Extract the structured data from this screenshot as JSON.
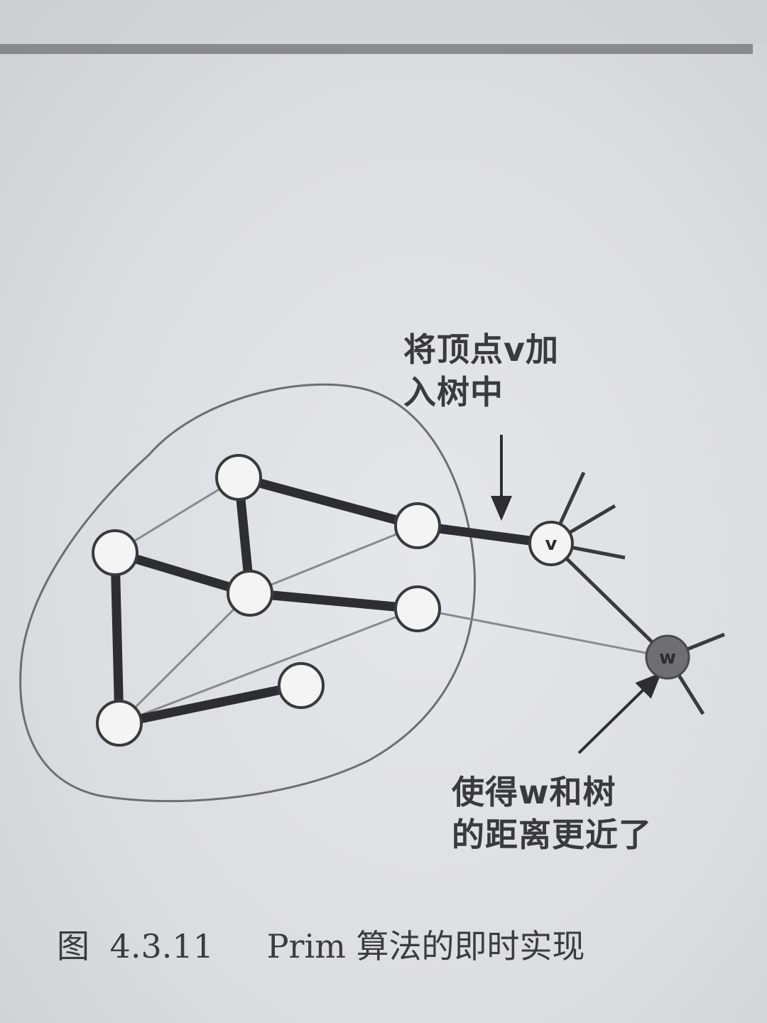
{
  "annotations": {
    "add_vertex_line1": "将顶点v加",
    "add_vertex_line2": "入树中",
    "closer_line1": "使得w和树",
    "closer_line2": "的距离更近了"
  },
  "caption": {
    "prefix": "图",
    "number": "4.3.11",
    "title": "Prim 算法的即时实现"
  },
  "nodes": {
    "v_label": "v",
    "w_label": "w"
  },
  "colors": {
    "tree_edge": "#2e2e32",
    "thin_edge": "#8a8a8e",
    "highlight_node": "#6f6f73"
  }
}
